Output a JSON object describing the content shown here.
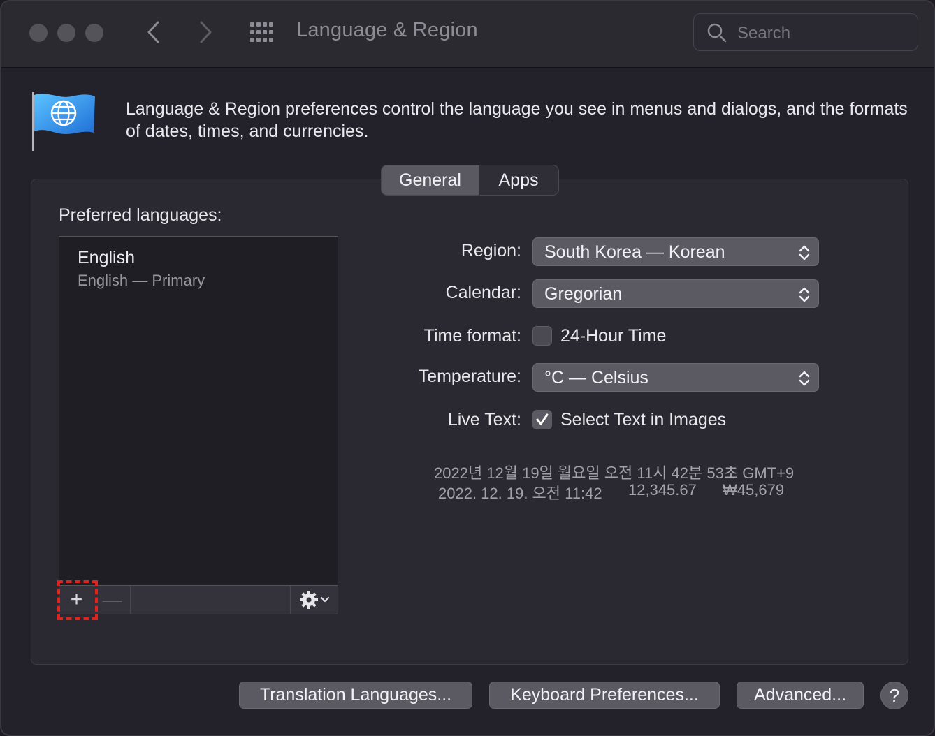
{
  "window": {
    "title": "Language & Region",
    "search_placeholder": "Search"
  },
  "header": {
    "description": "Language & Region preferences control the language you see in menus and dialogs, and the formats of dates, times, and currencies."
  },
  "tabs": [
    {
      "label": "General",
      "selected": true
    },
    {
      "label": "Apps",
      "selected": false
    }
  ],
  "preferred_languages": {
    "label": "Preferred languages:",
    "items": [
      {
        "name": "English",
        "detail": "English — Primary"
      }
    ],
    "add_label": "+",
    "remove_label": "—"
  },
  "settings": {
    "region": {
      "label": "Region:",
      "value": "South Korea — Korean"
    },
    "calendar": {
      "label": "Calendar:",
      "value": "Gregorian"
    },
    "time_format": {
      "label": "Time format:",
      "option": "24-Hour Time",
      "checked": false
    },
    "temperature": {
      "label": "Temperature:",
      "value": "°C — Celsius"
    },
    "live_text": {
      "label": "Live Text:",
      "option": "Select Text in Images",
      "checked": true
    }
  },
  "sample": {
    "long_date": "2022년 12월 19일 월요일 오전 11시 42분 53초 GMT+9",
    "short_date": "2022. 12. 19. 오전 11:42",
    "number": "12,345.67",
    "currency": "₩45,679"
  },
  "buttons": {
    "translation": "Translation Languages...",
    "keyboard": "Keyboard Preferences...",
    "advanced": "Advanced...",
    "help": "?"
  },
  "colors": {
    "highlight": "#e0231c",
    "flag_blue": "#2f9cf0"
  }
}
